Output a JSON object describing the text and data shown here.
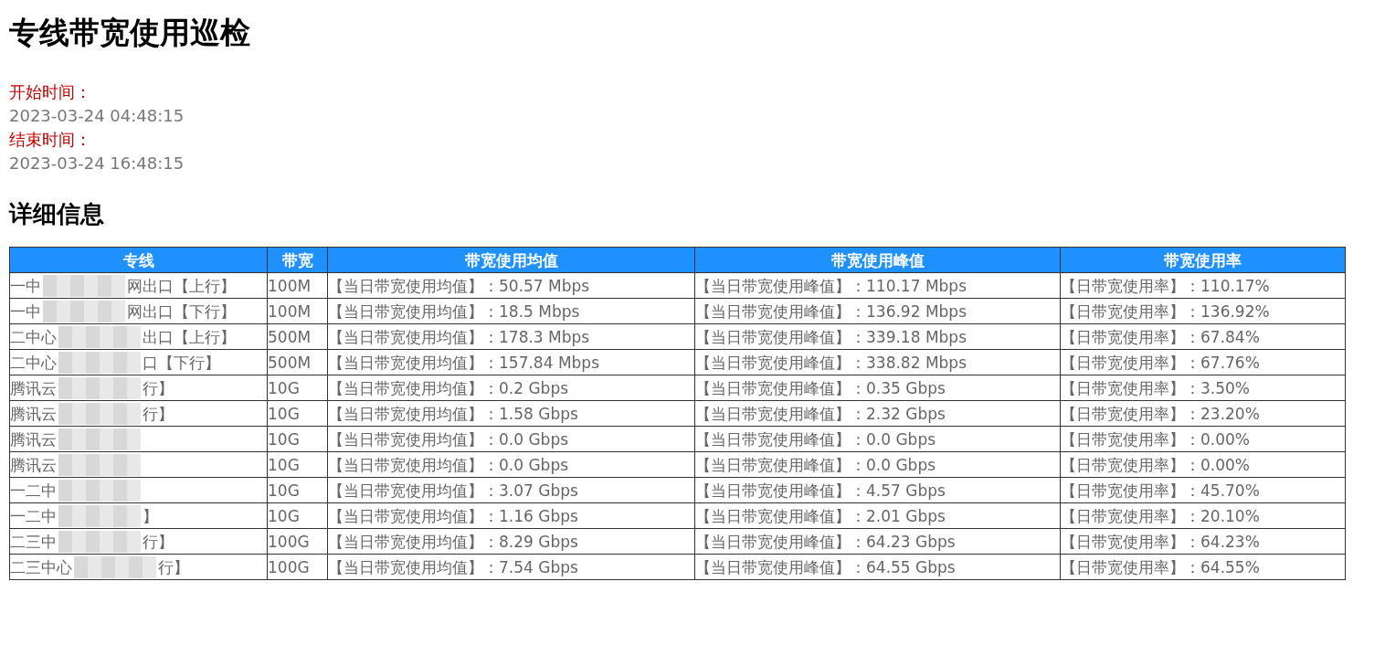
{
  "title": "专线带宽使用巡检",
  "start": {
    "label": "开始时间：",
    "value": "2023-03-24 04:48:15"
  },
  "end": {
    "label": "结束时间：",
    "value": "2023-03-24 16:48:15"
  },
  "section_title": "详细信息",
  "table": {
    "columns": [
      "专线",
      "带宽",
      "带宽使用均值",
      "带宽使用峰值",
      "带宽使用率"
    ],
    "rows": [
      {
        "line_head": "一中",
        "line_tail": "网出口【上行】",
        "bandwidth": "100M",
        "avg": "【当日带宽使用均值】：50.57 Mbps",
        "peak": "【当日带宽使用峰值】：110.17 Mbps",
        "rate": "【日带宽使用率】：110.17%"
      },
      {
        "line_head": "一中",
        "line_tail": "网出口【下行】",
        "bandwidth": "100M",
        "avg": "【当日带宽使用均值】：18.5 Mbps",
        "peak": "【当日带宽使用峰值】：136.92 Mbps",
        "rate": "【日带宽使用率】：136.92%"
      },
      {
        "line_head": "二中心",
        "line_tail": "出口【上行】",
        "bandwidth": "500M",
        "avg": "【当日带宽使用均值】：178.3 Mbps",
        "peak": "【当日带宽使用峰值】：339.18 Mbps",
        "rate": "【日带宽使用率】：67.84%"
      },
      {
        "line_head": "二中心",
        "line_tail": "口【下行】",
        "bandwidth": "500M",
        "avg": "【当日带宽使用均值】：157.84 Mbps",
        "peak": "【当日带宽使用峰值】：338.82 Mbps",
        "rate": "【日带宽使用率】：67.76%"
      },
      {
        "line_head": "腾讯云",
        "line_tail": "行】",
        "bandwidth": "10G",
        "avg": "【当日带宽使用均值】：0.2 Gbps",
        "peak": "【当日带宽使用峰值】：0.35 Gbps",
        "rate": "【日带宽使用率】：3.50%"
      },
      {
        "line_head": "腾讯云",
        "line_tail": "行】",
        "bandwidth": "10G",
        "avg": "【当日带宽使用均值】：1.58 Gbps",
        "peak": "【当日带宽使用峰值】：2.32 Gbps",
        "rate": "【日带宽使用率】：23.20%"
      },
      {
        "line_head": "腾讯云",
        "bandwidth": "10G",
        "avg": "【当日带宽使用均值】：0.0 Gbps",
        "peak": "【当日带宽使用峰值】：0.0 Gbps",
        "rate": "【日带宽使用率】：0.00%"
      },
      {
        "line_head": "腾讯云",
        "bandwidth": "10G",
        "avg": "【当日带宽使用均值】：0.0 Gbps",
        "peak": "【当日带宽使用峰值】：0.0 Gbps",
        "rate": "【日带宽使用率】：0.00%"
      },
      {
        "line_head": "一二中",
        "bandwidth": "10G",
        "avg": "【当日带宽使用均值】：3.07 Gbps",
        "peak": "【当日带宽使用峰值】：4.57 Gbps",
        "rate": "【日带宽使用率】：45.70%"
      },
      {
        "line_head": "一二中",
        "line_tail": "】",
        "bandwidth": "10G",
        "avg": "【当日带宽使用均值】：1.16 Gbps",
        "peak": "【当日带宽使用峰值】：2.01 Gbps",
        "rate": "【日带宽使用率】：20.10%"
      },
      {
        "line_head": "二三中",
        "line_tail": "行】",
        "bandwidth": "100G",
        "avg": "【当日带宽使用均值】：8.29 Gbps",
        "peak": "【当日带宽使用峰值】：64.23 Gbps",
        "rate": "【日带宽使用率】：64.23%"
      },
      {
        "line_head": "二三中心",
        "line_tail": "行】",
        "bandwidth": "100G",
        "avg": "【当日带宽使用均值】：7.54 Gbps",
        "peak": "【当日带宽使用峰值】：64.55 Gbps",
        "rate": "【日带宽使用率】：64.55%"
      }
    ]
  }
}
